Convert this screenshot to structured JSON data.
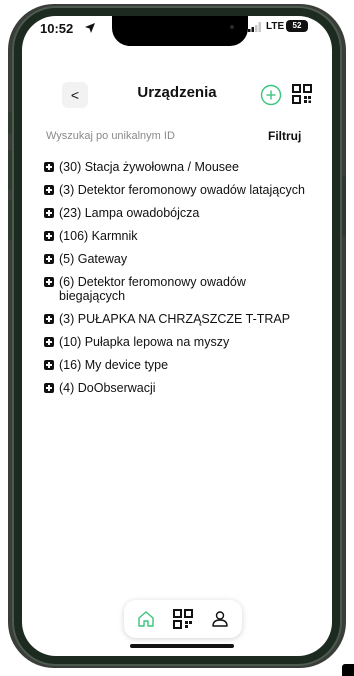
{
  "status_bar": {
    "time": "10:52",
    "network": "LTE",
    "battery": "52"
  },
  "header": {
    "title": "Urządzenia",
    "back_label": "<"
  },
  "search": {
    "placeholder": "Wyszukaj po unikalnym ID"
  },
  "filter_label": "Filtruj",
  "device_types": [
    "(30) Stacja żywołowna / Mousee",
    "(3) Detektor feromonowy owadów latających",
    "(23) Lampa owadobójcza",
    "(106) Karmnik",
    "(5) Gateway",
    "(6) Detektor feromonowy owadów biegających",
    "(3) PUŁAPKA NA CHRZĄSZCZE T-TRAP",
    "(10) Pułapka lepowa na myszy",
    "(16) My device type",
    "(4) DoObserwacji"
  ],
  "colors": {
    "accent": "#3cc47c",
    "text": "#111111",
    "muted": "#8a8a8a"
  },
  "icons": {
    "back": "chevron-left-icon",
    "add": "plus-circle-icon",
    "qr": "qr-code-icon",
    "home": "home-icon",
    "scan": "qr-code-icon",
    "profile": "user-icon"
  }
}
